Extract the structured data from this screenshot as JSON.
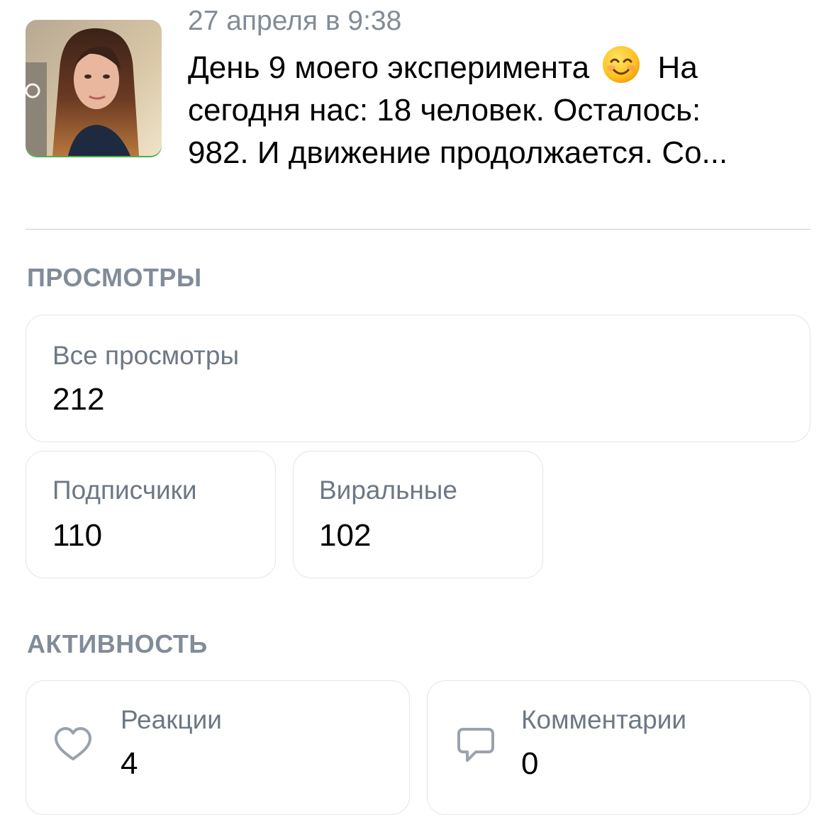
{
  "post": {
    "date": "27 апреля в 9:38",
    "text_lines": [
      "День 9 моего эксперимента",
      "сегодня нас: 18 человек. Осталось:",
      "982. И движение продолжается. Со..."
    ],
    "text_line1_tail": "На",
    "emoji": "smiling-face-emoji"
  },
  "views": {
    "section_title": "ПРОСМОТРЫ",
    "all": {
      "label": "Все просмотры",
      "value": "212"
    },
    "subscribers": {
      "label": "Подписчики",
      "value": "110"
    },
    "viral": {
      "label": "Виральные",
      "value": "102"
    }
  },
  "activity": {
    "section_title": "АКТИВНОСТЬ",
    "reactions": {
      "label": "Реакции",
      "value": "4",
      "icon": "heart-icon"
    },
    "comments": {
      "label": "Комментарии",
      "value": "0",
      "icon": "comment-icon"
    }
  },
  "colors": {
    "secondary_text": "#818c99",
    "card_border": "#e3e5e8",
    "icon": "#99a2ad"
  }
}
